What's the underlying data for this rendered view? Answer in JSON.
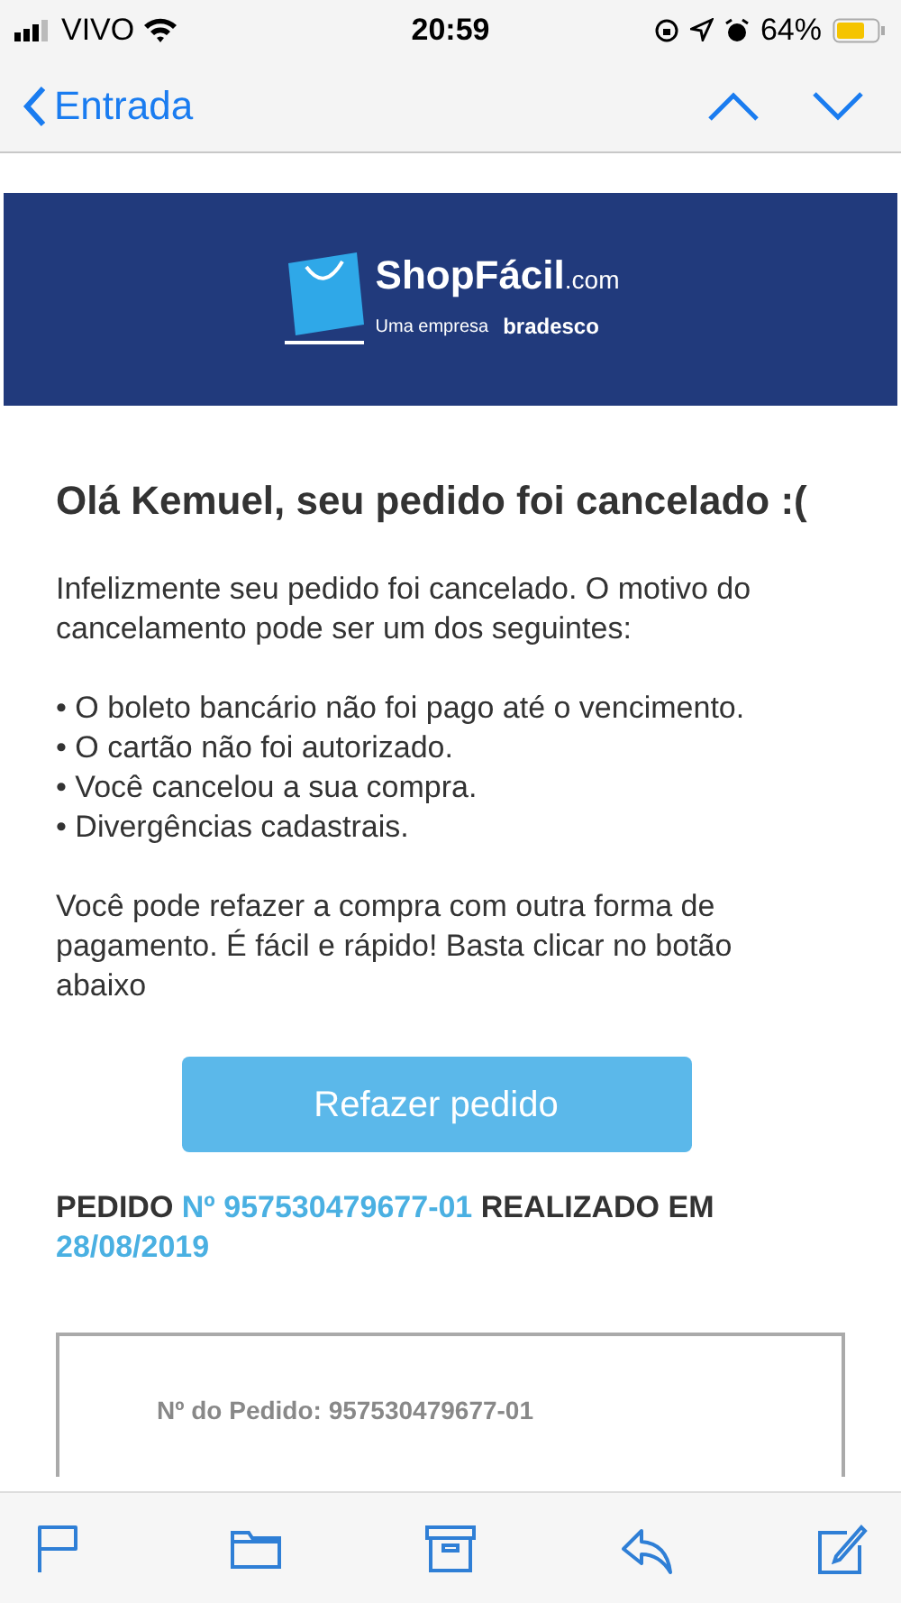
{
  "status_bar": {
    "carrier": "VIVO",
    "time": "20:59",
    "battery": "64%"
  },
  "nav": {
    "back_label": "Entrada"
  },
  "banner": {
    "brand": "ShopFácil",
    "brand_suffix": ".com",
    "tagline": "Uma empresa",
    "parent": "bradesco"
  },
  "email": {
    "heading": "Olá Kemuel, seu pedido foi cancelado :(",
    "intro": "Infelizmente seu pedido foi cancelado. O motivo do cancelamento pode ser um dos seguintes:",
    "reasons": [
      "• O boleto bancário não foi pago até o vencimento.",
      "• O cartão não foi autorizado.",
      "• Você cancelou a sua compra.",
      "• Divergências cadastrais."
    ],
    "outro": "Você pode refazer a compra com outra forma de pagamento. É fácil e rápido! Basta clicar no botão abaixo",
    "button": "Refazer pedido",
    "order_line": [
      {
        "text": "PEDIDO ",
        "highlight": false
      },
      {
        "text": "Nº 957530479677-01",
        "highlight": true
      },
      {
        "text": " REALIZADO EM ",
        "highlight": false
      },
      {
        "text": "28/08/2019",
        "highlight": true
      }
    ],
    "order_card": {
      "number_line": "Nº do Pedido: 957530479677-01"
    }
  }
}
